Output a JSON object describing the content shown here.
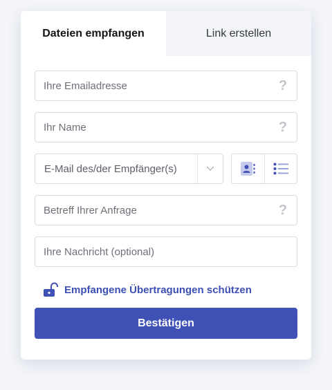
{
  "tabs": [
    {
      "label": "Dateien empfangen",
      "active": true
    },
    {
      "label": "Link erstellen",
      "active": false
    }
  ],
  "form": {
    "email_placeholder": "Ihre Emailadresse",
    "name_placeholder": "Ihr Name",
    "recipients_placeholder": "E-Mail des/der Empfänger(s)",
    "subject_placeholder": "Betreff Ihrer Anfrage",
    "message_placeholder": "Ihre Nachricht (optional)",
    "help_glyph": "?"
  },
  "protect": {
    "label": "Empfangene Übertragungen schützen",
    "icon": "unlocked-padlock-icon"
  },
  "confirm_label": "Bestätigen",
  "colors": {
    "accent": "#3f51b5",
    "link": "#3d4fb3",
    "background": "#f3f5fa"
  }
}
